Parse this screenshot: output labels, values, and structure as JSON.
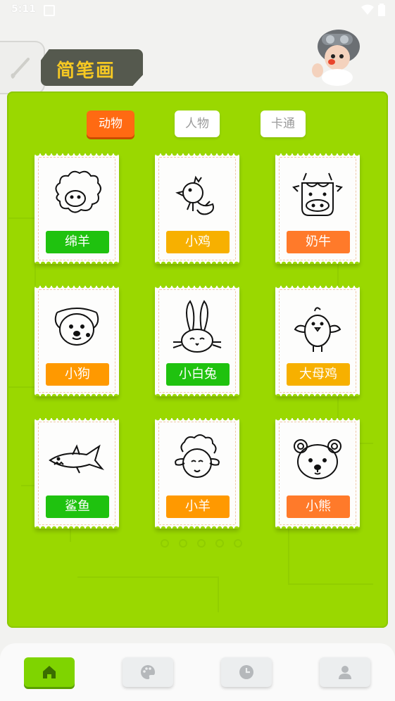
{
  "status_bar": {
    "time": "5:11"
  },
  "header": {
    "title": "简笔画"
  },
  "tabs": [
    {
      "label": "动物",
      "active": true
    },
    {
      "label": "人物",
      "active": false
    },
    {
      "label": "卡通",
      "active": false
    }
  ],
  "cards": [
    {
      "label": "绵羊",
      "icon": "sheep-drawing-icon",
      "color": "#1fc20f"
    },
    {
      "label": "小鸡",
      "icon": "chick-drawing-icon",
      "color": "#f7b000"
    },
    {
      "label": "奶牛",
      "icon": "cow-drawing-icon",
      "color": "#ff7a2a"
    },
    {
      "label": "小狗",
      "icon": "dog-drawing-icon",
      "color": "#ff9900"
    },
    {
      "label": "小白兔",
      "icon": "rabbit-drawing-icon",
      "color": "#1fc20f"
    },
    {
      "label": "大母鸡",
      "icon": "hen-drawing-icon",
      "color": "#f7b000"
    },
    {
      "label": "鲨鱼",
      "icon": "shark-drawing-icon",
      "color": "#1fc20f"
    },
    {
      "label": "小羊",
      "icon": "lamb-drawing-icon",
      "color": "#ff9900"
    },
    {
      "label": "小熊",
      "icon": "bear-drawing-icon",
      "color": "#ff7a2a"
    }
  ],
  "bottom_nav": [
    {
      "icon": "home-icon",
      "active": true
    },
    {
      "icon": "palette-icon",
      "active": false
    },
    {
      "icon": "clock-icon",
      "active": false
    },
    {
      "icon": "profile-icon",
      "active": false
    }
  ],
  "colors": {
    "panel": "#9ad800",
    "tab_active": "#ff6a12",
    "title_text": "#f5c823"
  }
}
